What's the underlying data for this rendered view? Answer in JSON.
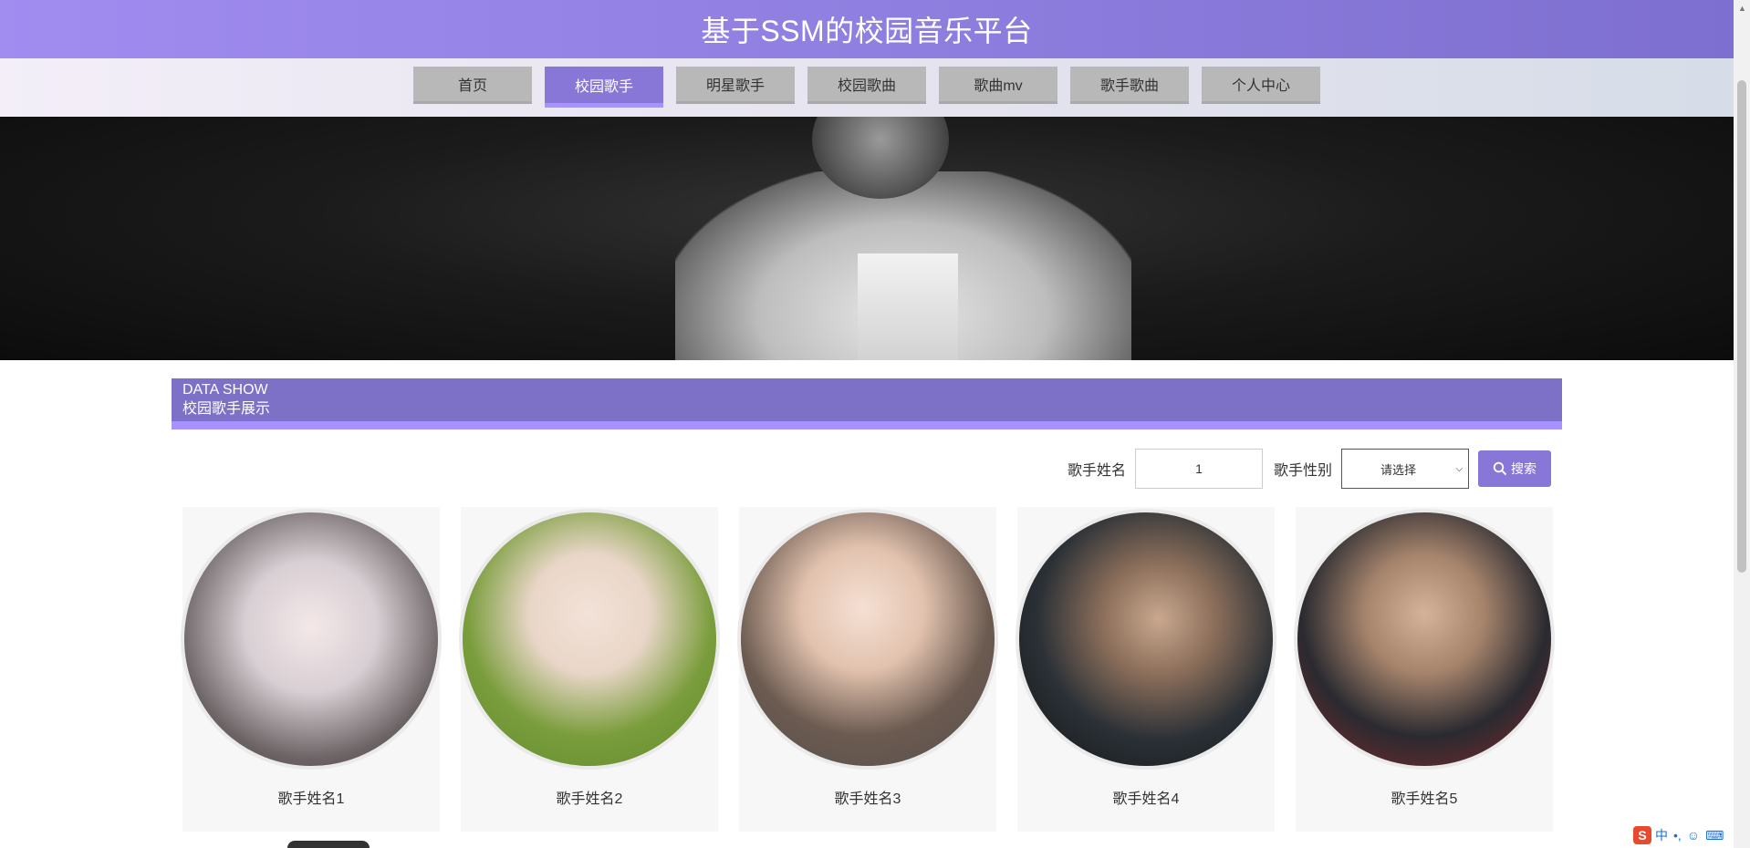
{
  "header": {
    "title": "基于SSM的校园音乐平台"
  },
  "nav": {
    "items": [
      {
        "label": "首页",
        "active": false
      },
      {
        "label": "校园歌手",
        "active": true
      },
      {
        "label": "明星歌手",
        "active": false
      },
      {
        "label": "校园歌曲",
        "active": false
      },
      {
        "label": "歌曲mv",
        "active": false
      },
      {
        "label": "歌手歌曲",
        "active": false
      },
      {
        "label": "个人中心",
        "active": false
      }
    ]
  },
  "section": {
    "title_en": "DATA SHOW",
    "title_cn": "校园歌手展示"
  },
  "search": {
    "name_label": "歌手姓名",
    "name_value": "1",
    "gender_label": "歌手性别",
    "gender_selected": "请选择",
    "button_label": "搜索"
  },
  "singers": [
    {
      "name": "歌手姓名1"
    },
    {
      "name": "歌手姓名2"
    },
    {
      "name": "歌手姓名3"
    },
    {
      "name": "歌手姓名4"
    },
    {
      "name": "歌手姓名5"
    }
  ],
  "ime": {
    "logo": "S",
    "mode": "中",
    "punct": "•,",
    "emoji_icon": "smiley-icon",
    "keyboard_icon": "keyboard-icon"
  },
  "colors": {
    "accent": "#8877d6",
    "accent_light": "#a792ff",
    "header_start": "#a18cf0",
    "header_end": "#7d6fcf"
  }
}
